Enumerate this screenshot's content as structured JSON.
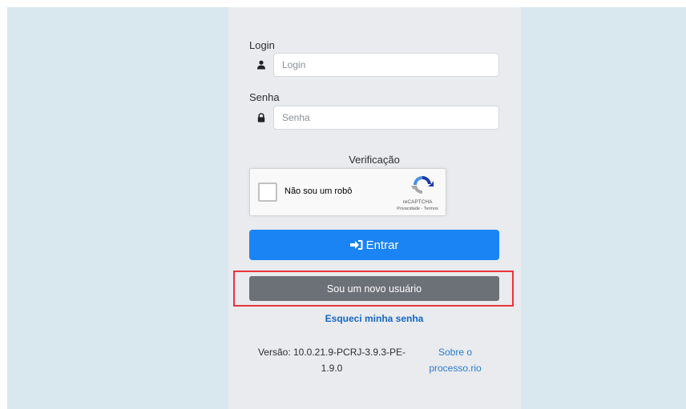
{
  "login": {
    "label": "Login",
    "placeholder": "Login",
    "value": ""
  },
  "password": {
    "label": "Senha",
    "placeholder": "Senha",
    "value": ""
  },
  "verification": {
    "label": "Verificação",
    "recaptcha_checkbox_text": "Não sou um robô",
    "recaptcha_brand": "reCAPTCHA",
    "recaptcha_links": "Privacidade - Termos"
  },
  "actions": {
    "enter_label": "Entrar",
    "new_user_label": "Sou um novo usuário",
    "forgot_password_label": "Esqueci minha senha"
  },
  "footer": {
    "version_line1": "Versão: 10.0.21.9-PCRJ-3.9.3-PE-",
    "version_line2": "1.9.0",
    "about_line1": "Sobre o",
    "about_line2": "processo.rio"
  },
  "icons": {
    "login_icon": "user-icon",
    "password_icon": "lock-icon",
    "enter_icon": "sign-in-icon",
    "recaptcha_logo": "recaptcha-logo-icon"
  },
  "colors": {
    "primary": "#1a84f5",
    "secondary": "#6c7077",
    "highlight": "#e8333c",
    "link": "#1466c8"
  }
}
